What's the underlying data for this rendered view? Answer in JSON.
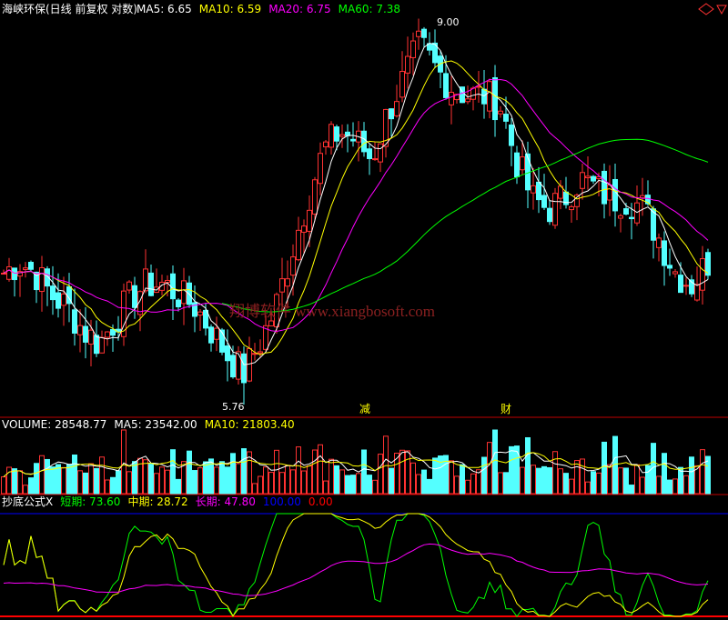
{
  "header": {
    "title": "海峡环保(日线 前复权 对数)",
    "ma": [
      {
        "label": "MA5: 6.65",
        "color": "#ffffff"
      },
      {
        "label": "MA10: 6.59",
        "color": "#ffff00"
      },
      {
        "label": "MA20: 6.75",
        "color": "#ff00ff"
      },
      {
        "label": "MA60: 7.38",
        "color": "#00ff00"
      }
    ]
  },
  "price_panel": {
    "high_label": "9.00",
    "low_label": "5.76",
    "signal_labels": [
      "减",
      "财"
    ],
    "watermark": "翔博软件 www.xiangbosoft.com"
  },
  "volume_panel": {
    "items": [
      {
        "label": "VOLUME: 28548.77",
        "color": "#ffffff"
      },
      {
        "label": "MA5: 23542.00",
        "color": "#ffffff"
      },
      {
        "label": "MA10: 21803.40",
        "color": "#ffff00"
      }
    ]
  },
  "indicator_panel": {
    "items": [
      {
        "label": "抄底公式X",
        "color": "#ffffff"
      },
      {
        "label": "短期: 73.60",
        "color": "#00ff00"
      },
      {
        "label": "中期: 28.72",
        "color": "#ffff00"
      },
      {
        "label": "长期: 47.80",
        "color": "#ff00ff"
      },
      {
        "label": "100.00",
        "color": "#0000ff"
      },
      {
        "label": "0.00",
        "color": "#ff0000"
      }
    ]
  },
  "colors": {
    "up": "#ff3232",
    "down": "#54ffff",
    "ma5": "#ffffff",
    "ma10": "#ffff00",
    "ma20": "#ff00ff",
    "ma60": "#00ff00",
    "short": "#00ff00",
    "mid": "#ffff00",
    "long": "#ff00ff"
  },
  "chart_data": {
    "type": "line",
    "title": "海峡环保(日线 前复权 对数)",
    "series_price_anchor": [
      6.6,
      6.7,
      6.6,
      6.4,
      6.3,
      6.1,
      6.0,
      6.2,
      6.4,
      6.5,
      6.5,
      6.4,
      6.3,
      6.1,
      5.9,
      5.76,
      6.0,
      6.3,
      6.8,
      7.3,
      7.8,
      8.0,
      7.9,
      7.7,
      8.2,
      8.6,
      9.0,
      8.7,
      8.5,
      8.4,
      8.4,
      8.3,
      7.7,
      7.3,
      7.2,
      7.3,
      7.5,
      7.4,
      7.3,
      7.3,
      7.2,
      6.9,
      6.6,
      6.5,
      6.7
    ],
    "price_range": [
      5.5,
      9.3
    ],
    "volume_ma": {
      "volume": 28548.77,
      "ma5": 23542.0,
      "ma10": 21803.4
    },
    "indicator": {
      "short": 73.6,
      "mid": 28.72,
      "long": 47.8,
      "upper": 100.0,
      "lower": 0.0
    }
  }
}
